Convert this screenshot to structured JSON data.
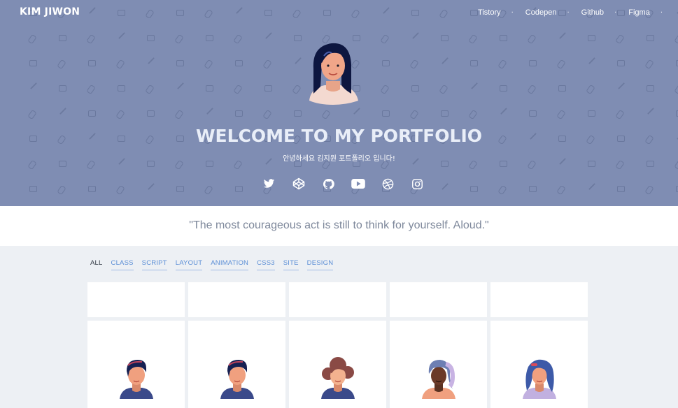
{
  "header": {
    "brand": "KIM JIWON",
    "nav": [
      {
        "label": "Tistory",
        "separator": "·"
      },
      {
        "label": "Codepen",
        "separator": "·"
      },
      {
        "label": "Github",
        "separator": "·"
      },
      {
        "label": "Figma",
        "separator": "·"
      }
    ]
  },
  "hero": {
    "title": "WELCOME TO MY PORTFOLIO",
    "subtitle": "안녕하세요 김지원 포트폴리오 입니다!",
    "social_icons": [
      "twitter-icon",
      "codepen-icon",
      "github-icon",
      "youtube-icon",
      "dribbble-icon",
      "instagram-icon"
    ]
  },
  "quote": "\"The most courageous act is still to think for yourself. Aloud.\"",
  "filters": [
    "ALL",
    "CLASS",
    "SCRIPT",
    "LAYOUT",
    "ANIMATION",
    "CSS3",
    "SITE",
    "DESIGN"
  ],
  "colors": {
    "hero_bg": "#7f8db3",
    "page_bg": "#edf0f4",
    "filter_link": "#5b8ed6",
    "quote_text": "#7e889b"
  },
  "cards": [
    {
      "avatar": "man-avatar-icon"
    },
    {
      "avatar": "man-avatar-icon"
    },
    {
      "avatar": "woman-curly-avatar-icon"
    },
    {
      "avatar": "woman-dark-avatar-icon"
    },
    {
      "avatar": "woman-blue-hair-avatar-icon"
    }
  ]
}
